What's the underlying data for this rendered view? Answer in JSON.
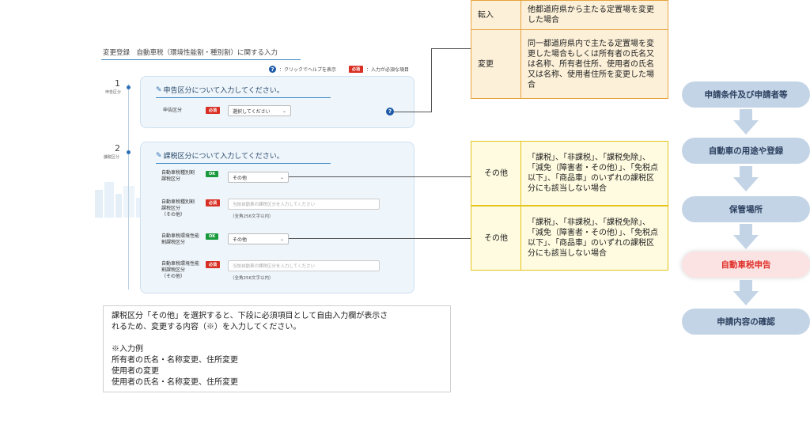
{
  "screen": {
    "title": "変更登録　自動車税（環境性能割・種別割）に関する入力",
    "help_text": "：クリックでヘルプを表示",
    "required_badge": "必須",
    "required_text": "：入力が必須な項目",
    "ok_badge": "OK"
  },
  "steps": [
    {
      "number": "1",
      "label": "申告区分",
      "card_title": "申告区分について入力してください。",
      "fields": [
        {
          "label": "申告区分",
          "badge": "必須",
          "value": "選択してください"
        }
      ]
    },
    {
      "number": "2",
      "label": "課税区分",
      "card_title": "課税区分について入力してください。",
      "fields": [
        {
          "label_lines": [
            "自動車税種別割",
            "課税区分"
          ],
          "badge": "OK",
          "value": "その他"
        },
        {
          "label_lines": [
            "自動車税種別割",
            "課税区分",
            "（その他）"
          ],
          "badge": "必須",
          "placeholder": "当該自動車の課税区分を入力してください",
          "note": "（全角256文字以内）"
        },
        {
          "label_lines": [
            "自動車税環境性能",
            "割課税区分"
          ],
          "badge": "OK",
          "value": "その他"
        },
        {
          "label_lines": [
            "自動車税環境性能",
            "割課税区分",
            "（その他）"
          ],
          "badge": "必須",
          "placeholder": "当該自動車の課税区分を入力してください",
          "note": "（全角256文字以内）"
        }
      ]
    }
  ],
  "declaration_table": [
    {
      "key": "転入",
      "desc": "他都道府県から主たる定置場を変更した場合"
    },
    {
      "key": "変更",
      "desc": "同一都道府県内で主たる定置場を変更した場合もしくは所有者の氏名又は名称、所有者住所、使用者の氏名又は名称、使用者住所を変更した場合"
    }
  ],
  "other_tables": [
    {
      "key": "その他",
      "desc": "「課税」、「非課税」、「課税免除」、「減免（障害者・その他）」、「免税点以下」、「商品車」のいずれの課税区分にも該当しない場合"
    },
    {
      "key": "その他",
      "desc": "「課税」、「非課税」、「課税免除」、「減免（障害者・その他）」、「免税点以下」、「商品車」のいずれの課税区分にも該当しない場合"
    }
  ],
  "explanation": {
    "lines": [
      "課税区分「その他」を選択すると、下段に必須項目として自由入力欄が表示さ",
      "れるため、変更する内容（※）を入力してください。",
      "",
      "※入力例",
      "所有者の氏名・名称変更、住所変更",
      "使用者の変更",
      "使用者の氏名・名称変更、住所変更"
    ]
  },
  "flow": {
    "steps": [
      "申請条件及び申請者等",
      "自動車の用途や登録",
      "保管場所",
      "自動車税申告",
      "申請内容の確認"
    ],
    "active_index": 3
  },
  "colors": {
    "accent_blue": "#3b86c2",
    "required_red": "#d93025",
    "ok_green": "#1a9a3c",
    "flow_active_text": "#e0302a",
    "orange_border": "#e7a33e",
    "yellow_border": "#e3c41a"
  }
}
